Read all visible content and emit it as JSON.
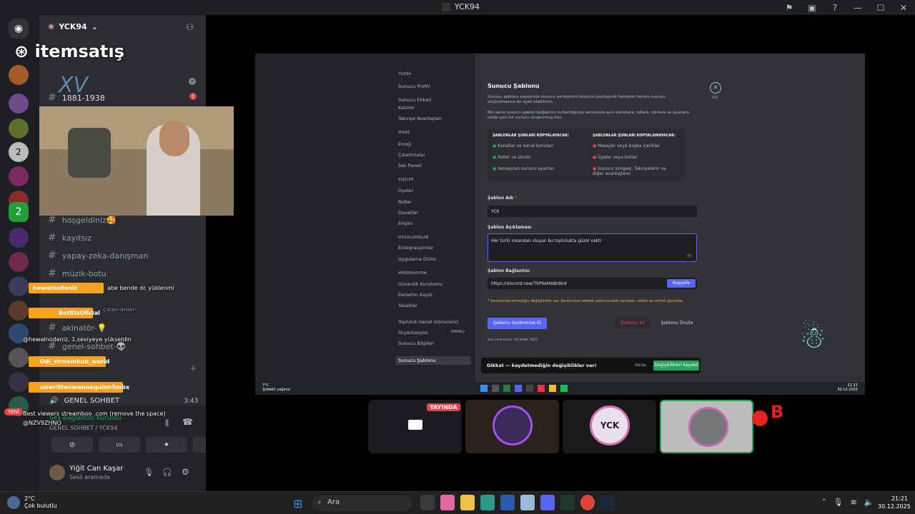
{
  "window": {
    "title": "YCK94"
  },
  "server": {
    "name": "YCK94",
    "channels": [
      {
        "label": "hoşgeldiniz🥰"
      },
      {
        "label": "kayıtsız"
      },
      {
        "label": "yapay-zeka-danışman"
      },
      {
        "label": "müzik-botu"
      },
      {
        "label": "akinatör-💡"
      },
      {
        "label": "genel-sohbet-👽"
      }
    ],
    "partial_channel": "1881-1938",
    "voice_category": "GENEL SOHBET",
    "voice_time": "3:43",
    "muted_note": "Ses Bağlantısı Kuruldu",
    "voice_location": "GENEL SOHBET / YCK94",
    "new_label": "YENİ"
  },
  "user": {
    "name": "Yiğit Can Kaşar",
    "status": "Sesli aramada"
  },
  "brand_overlay": {
    "logo_text": "itemsatış",
    "tag_text": "XV"
  },
  "chat_overlay": [
    {
      "name": "hewalnodeniz",
      "message": "abe bende dc yüklenmi"
    },
    {
      "name": "BotRixOficial",
      "message": "çıkan-anlar-"
    },
    {
      "name": "",
      "message": "@hewalnodeniz, 1.seviyeye yükseldin"
    },
    {
      "name": "Odi_streamhub_world",
      "message": ""
    },
    {
      "name": "unwrittenmannequinn5mbx",
      "message": ""
    },
    {
      "name": "",
      "message": "Best viewers streamboo .com (remove the space)"
    },
    {
      "name": "",
      "message": "@NZV9ZHNO"
    }
  ],
  "settings_window": {
    "server_label": "YCK94",
    "nav": [
      {
        "label": "Sunucu Profili",
        "type": "item"
      },
      {
        "label": "Sunucu Etiketi",
        "type": "item"
      },
      {
        "label": "Katılım",
        "type": "item"
      },
      {
        "label": "Takviye Avantajları",
        "type": "item"
      },
      {
        "label": "İFADE",
        "type": "header"
      },
      {
        "label": "Emoji",
        "type": "item"
      },
      {
        "label": "Çıkartmalar",
        "type": "item"
      },
      {
        "label": "Ses Paneli",
        "type": "item"
      },
      {
        "label": "KİŞİLER",
        "type": "header"
      },
      {
        "label": "Üyeler",
        "type": "item"
      },
      {
        "label": "Roller",
        "type": "item"
      },
      {
        "label": "Davetler",
        "type": "item"
      },
      {
        "label": "Erişim",
        "type": "item"
      },
      {
        "label": "UYGULAMALAR",
        "type": "header"
      },
      {
        "label": "Entegrasyonlar",
        "type": "item"
      },
      {
        "label": "Uygulama Dizini",
        "type": "item"
      },
      {
        "label": "MODERASYON",
        "type": "header"
      },
      {
        "label": "Güvenlik Kurulumu",
        "type": "item"
      },
      {
        "label": "Denetim Kaydı",
        "type": "item"
      },
      {
        "label": "Yasaklar",
        "type": "item"
      },
      {
        "label": "Topluluk Genel Görünümü",
        "type": "item"
      },
      {
        "label": "Oryantasyon",
        "type": "item",
        "extra": "KAPALI"
      },
      {
        "label": "Sunucu Bilgileri",
        "type": "item"
      },
      {
        "label": "Sunucu Şablonu",
        "type": "selected"
      }
    ],
    "title": "Sunucu Şablonu",
    "desc1": "Sunucu şablonu sayesinde sunucu yerleşimini kolayca paylaşarak herkesin hemen sunucu oluşturmasına ön ayak olabilirsin.",
    "desc2": "Biri senin sunucu şablon bağlantını kullandığında seninkiyle aynı kanallara, rollere, izinlere ve ayarlara sahip yeni bir sunucu oluşturmuş olur.",
    "copy_header": "ŞABLONLAR ŞUNLARI KOPYALAYACAK:",
    "copy_items": [
      "Kanallar ve kanal konuları",
      "Roller ve izinler",
      "Varsayılan sunucu ayarları"
    ],
    "nocopy_header": "ŞABLONLAR ŞUNLARI KOPYALAMAYACAK:",
    "nocopy_items": [
      "Mesajlar veya başka içerikler",
      "Üyeler veya botlar",
      "Sunucu simgesi, Takviyelerin ve diğer avantajların"
    ],
    "name_label": "Şablon Adı",
    "name_value": "YCK",
    "desc_label": "Şablon Açıklaması",
    "desc_value": "Her türlü insandan oluşan bu toplulukta güzel vakti",
    "link_label": "Şablon Bağlantısı",
    "link_value": "https://discord.new/TkP6eMABnNrd",
    "copy_button": "Kopyala",
    "sync_note": "* Senkronize etmediğin değişiklikler var. Senkronize ederek şablonundaki kanalları, rolleri ve izinleri güncelle.",
    "sync_button": "Şablonu Senkronize Et",
    "last_sync": "Son senkronize: 19 Aralık 2025",
    "delete_button": "Şablonu Sil",
    "preview_button": "Şablonu Önizle",
    "esc": "ESC",
    "unsaved_text": "Dikkat — kaydetmediğin değişiklikler var!",
    "reset_button": "Sıfırla",
    "save_button": "Değişiklikleri Kaydet"
  },
  "inner_taskbar": {
    "weather_temp": "7°C",
    "weather_text": "Şiddetli yağmur",
    "time": "21:21",
    "date": "30.12.2025"
  },
  "tiles": [
    {
      "label": "YAYINDA"
    },
    {
      "label": ""
    },
    {
      "label": "YCK"
    },
    {
      "label": ""
    }
  ],
  "taskbar": {
    "weather_temp": "2°C",
    "weather_text": "Çok bulutlu",
    "search_placeholder": "Ara",
    "time": "21:21",
    "date": "30.12.2025"
  },
  "colors": {
    "accent": "#5865f2",
    "green": "#23a55a",
    "red": "#f23f43",
    "overlay_orange": "#f7a21c"
  }
}
